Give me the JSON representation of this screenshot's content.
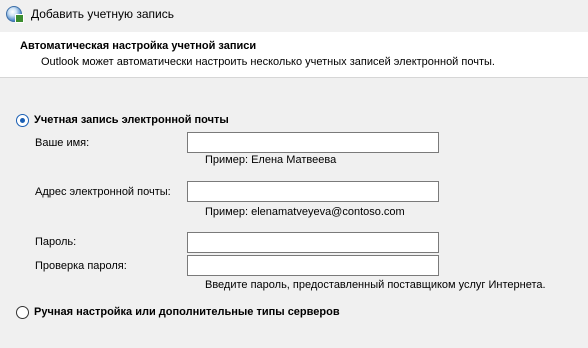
{
  "window": {
    "title": "Добавить учетную запись",
    "icon": "outlook-globe-icon"
  },
  "header": {
    "title": "Автоматическая настройка учетной записи",
    "subtitle": "Outlook может автоматически настроить несколько учетных записей электронной почты."
  },
  "options": {
    "email_account": {
      "label": "Учетная запись электронной почты",
      "selected": true
    },
    "manual_setup": {
      "label": "Ручная настройка или дополнительные типы серверов",
      "selected": false
    }
  },
  "form": {
    "name_label": "Ваше имя:",
    "name_value": "",
    "name_hint": "Пример: Елена Матвеева",
    "email_label": "Адрес электронной почты:",
    "email_value": "",
    "email_hint": "Пример: elenamatveyeva@contoso.com",
    "password_label": "Пароль:",
    "password_value": "",
    "confirm_label": "Проверка пароля:",
    "confirm_value": "",
    "password_hint": "Введите пароль, предоставленный поставщиком услуг Интернета."
  }
}
